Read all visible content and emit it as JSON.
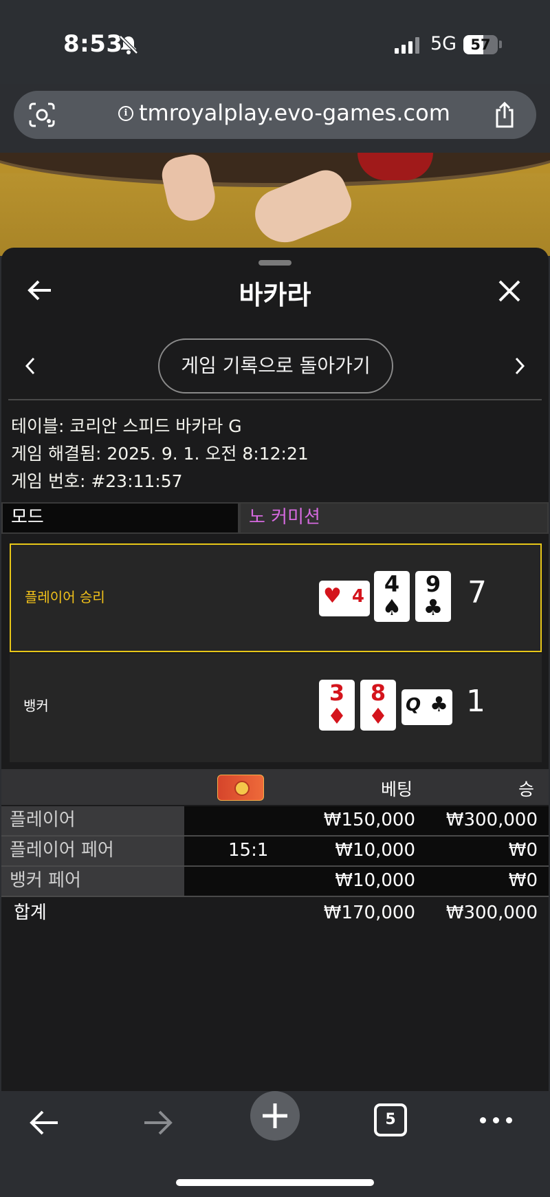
{
  "status_bar": {
    "time": "8:53",
    "network": "5G",
    "battery": "57",
    "battery_level": 0.57
  },
  "browser": {
    "url": "tmroyalplay.evo-games.com",
    "open_tabs": "5"
  },
  "panel": {
    "title": "바카라",
    "history_button": "게임 기록으로 돌아가기",
    "info": {
      "table": "테이블: 코리안 스피드 바카라 G",
      "resolved": "게임 해결됨: 2025. 9. 1. 오전 8:12:21",
      "game_number": "게임 번호: #23:11:57"
    },
    "mode": {
      "label": "모드",
      "value": "노 커미션"
    },
    "outcomes": [
      {
        "label": "플레이어 승리",
        "score": "7",
        "winner": true,
        "cards": [
          {
            "rank": "4",
            "suit": "♥",
            "side": true,
            "red": true
          },
          {
            "rank": "4",
            "suit": "♠",
            "side": false,
            "red": false
          },
          {
            "rank": "9",
            "suit": "♣",
            "side": false,
            "red": false
          }
        ]
      },
      {
        "label": "뱅커",
        "score": "1",
        "winner": false,
        "cards": [
          {
            "rank": "3",
            "suit": "♦",
            "side": false,
            "red": true
          },
          {
            "rank": "8",
            "suit": "♦",
            "side": false,
            "red": true
          },
          {
            "rank": "Q",
            "suit": "♣",
            "side": true,
            "red": false
          }
        ]
      }
    ],
    "bets": {
      "header": {
        "bet": "베팅",
        "win": "승"
      },
      "rows": [
        {
          "label": "플레이어",
          "odds": "",
          "bet": "₩150,000",
          "win": "₩300,000"
        },
        {
          "label": "플레이어 페어",
          "odds": "15:1",
          "bet": "₩10,000",
          "win": "₩0"
        },
        {
          "label": "뱅커 페어",
          "odds": "",
          "bet": "₩10,000",
          "win": "₩0"
        }
      ],
      "total": {
        "label": "합계",
        "bet": "₩170,000",
        "win": "₩300,000"
      }
    }
  },
  "colors": {
    "winner_border": "#e8c718",
    "mode_value": "#d66ae0",
    "red_suit": "#d4141c"
  }
}
